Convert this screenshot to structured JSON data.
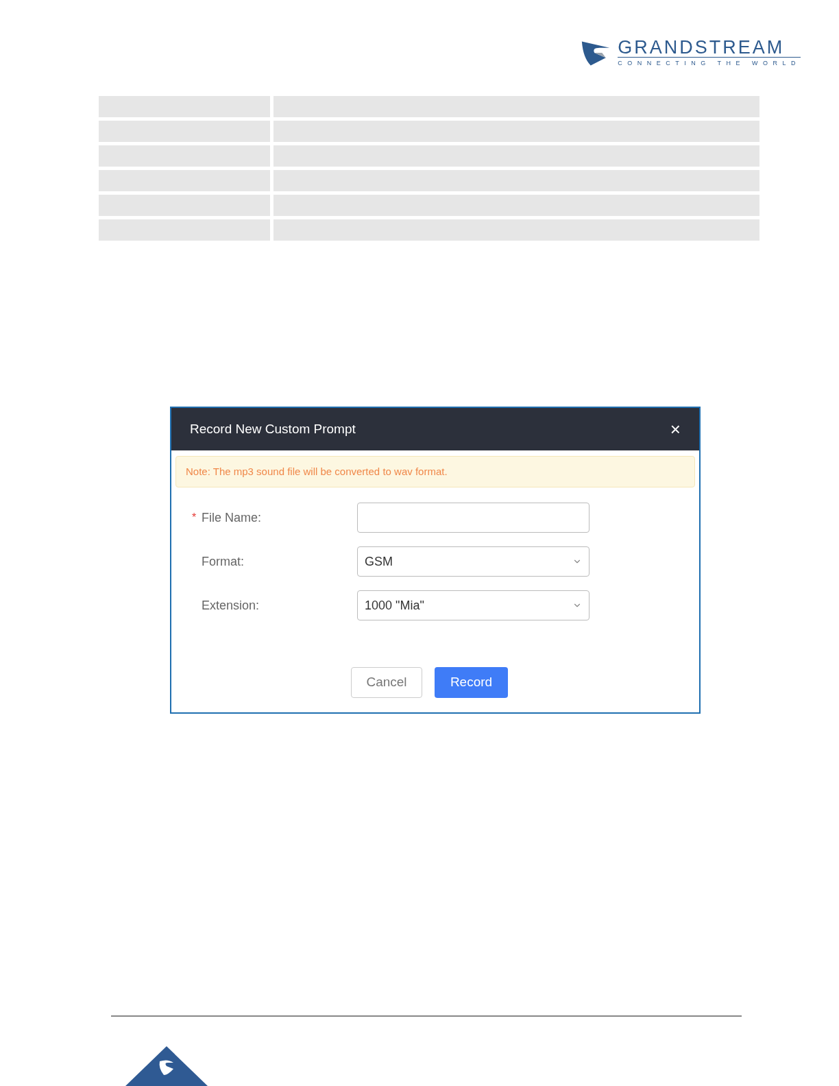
{
  "header": {
    "brand": "GRANDSTREAM",
    "tagline": "CONNECTING THE WORLD"
  },
  "dialog": {
    "title": "Record New Custom Prompt",
    "close": "×",
    "note": "Note: The mp3 sound file will be converted to wav format.",
    "required_mark": "*",
    "fields": [
      {
        "kind": "text",
        "label": "File Name:",
        "required": true
      },
      {
        "kind": "select",
        "label": "Format:",
        "required": false,
        "value": "GSM"
      },
      {
        "kind": "select",
        "label": "Extension:",
        "required": false,
        "value": "1000 \"Mia\""
      }
    ],
    "buttons": [
      {
        "kind": "secondary",
        "label": "Cancel"
      },
      {
        "kind": "primary",
        "label": "Record"
      }
    ]
  }
}
